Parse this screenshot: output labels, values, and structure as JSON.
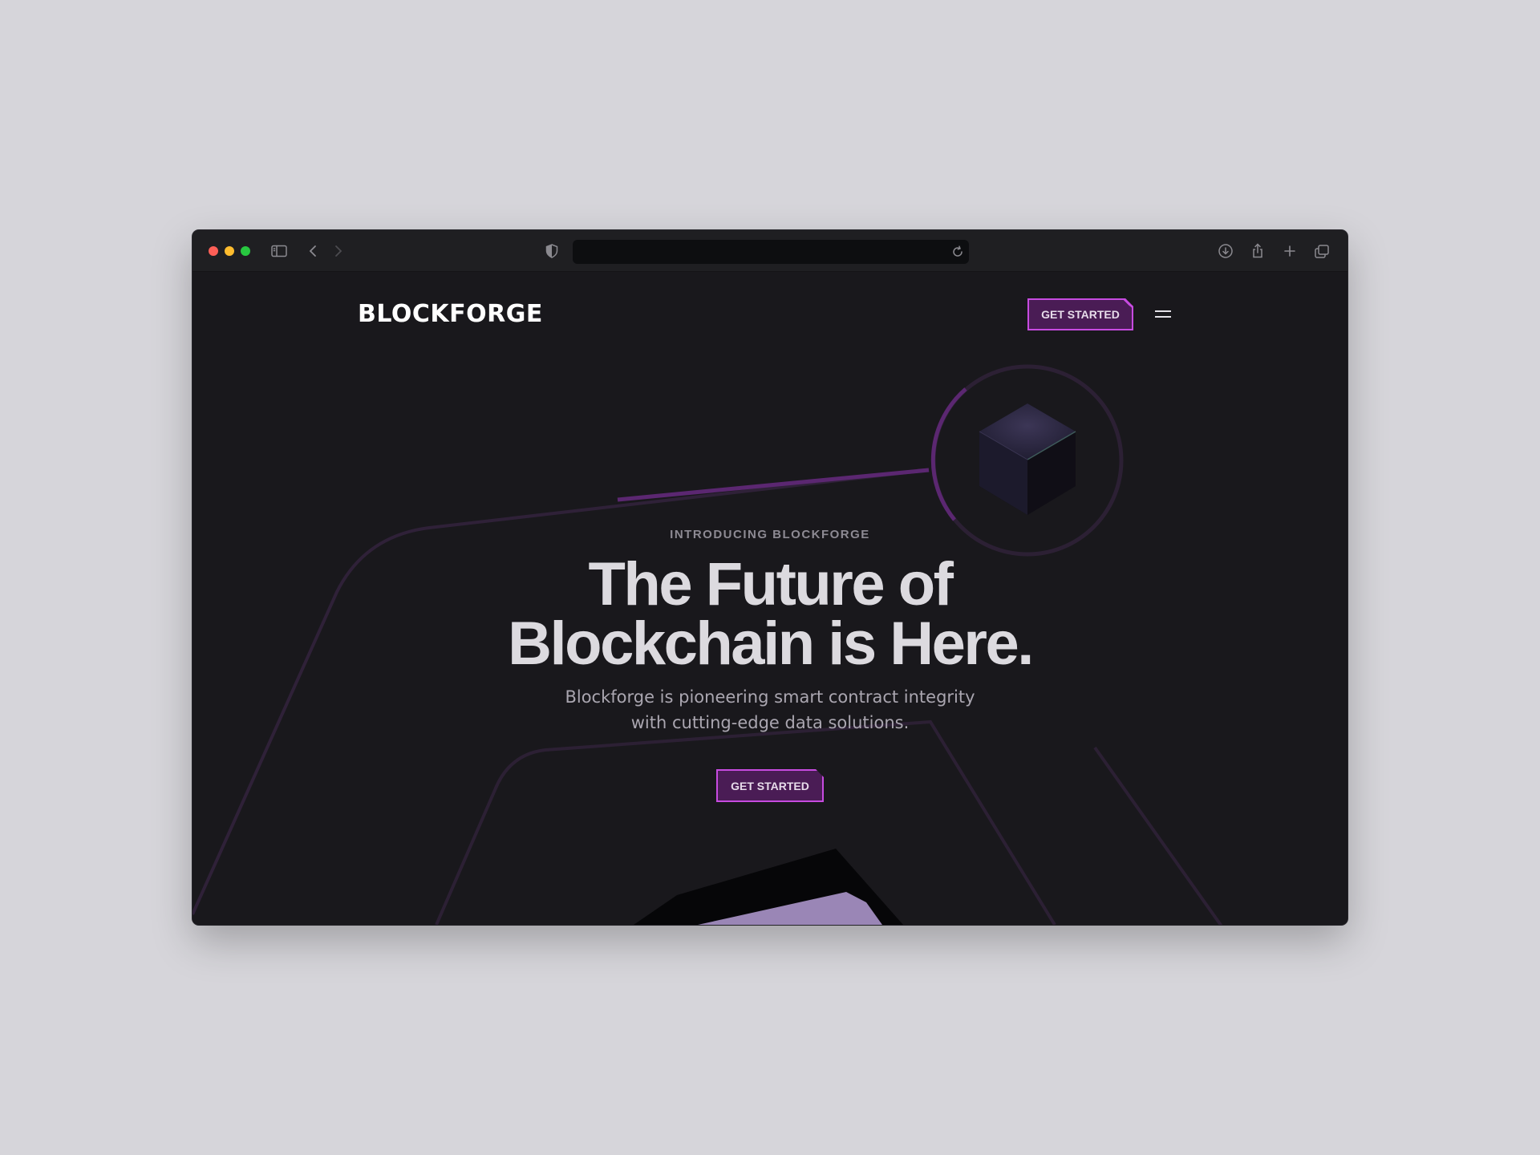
{
  "browser": {
    "url": "",
    "icons": {
      "sidebar": "sidebar-icon",
      "back": "chevron-left-icon",
      "forward": "chevron-right-icon",
      "privacy": "shield-icon",
      "reload": "reload-icon",
      "downloads": "download-icon",
      "share": "share-icon",
      "new_tab": "plus-icon",
      "tabs": "tabs-overview-icon"
    }
  },
  "site": {
    "logo": "BLOCKFORGE",
    "nav_cta": "GET STARTED",
    "menu_icon": "hamburger-menu-icon"
  },
  "hero": {
    "eyebrow": "INTRODUCING BLOCKFORGE",
    "headline_line1": "The Future of",
    "headline_line2": "Blockchain is Here.",
    "subtitle_line1": "Blockforge is pioneering smart contract integrity",
    "subtitle_line2": "with cutting-edge data solutions.",
    "cta": "GET STARTED"
  },
  "colors": {
    "page_bg": "#19181c",
    "accent": "#c74be0",
    "accent_fill": "#4a1c55",
    "line": "#3a2547",
    "line_bright": "#6a2d82"
  }
}
